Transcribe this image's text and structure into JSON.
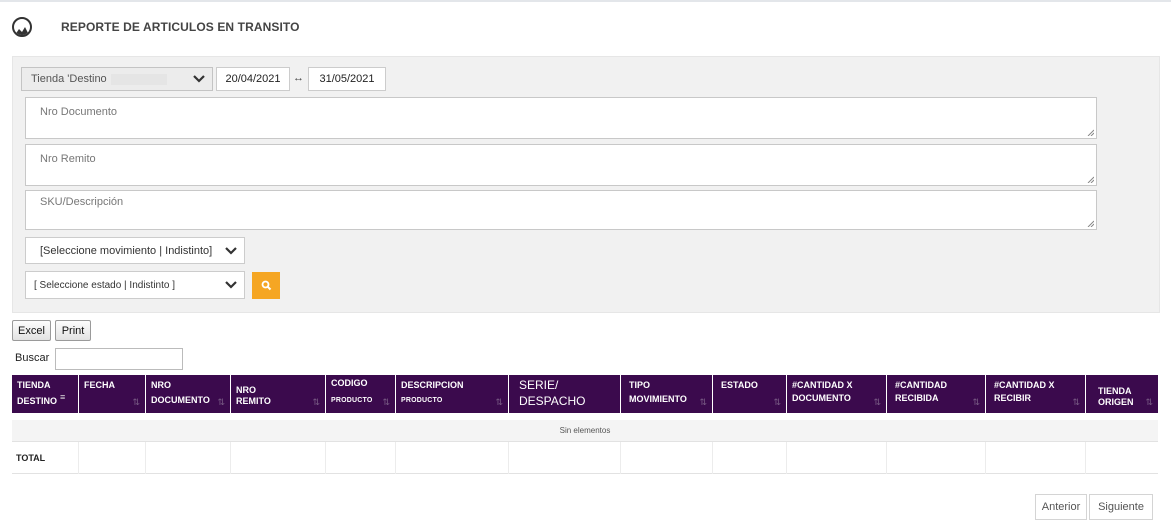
{
  "page": {
    "title": "REPORTE DE ARTICULOS EN TRANSITO"
  },
  "filters": {
    "store": {
      "label": "Tienda 'Destino"
    },
    "date_from": "20/04/2021",
    "date_range_arrow": "↔",
    "date_to": "31/05/2021",
    "nro_documento_placeholder": "Nro Documento",
    "nro_remito_placeholder": "Nro Remito",
    "sku_placeholder": "SKU/Descripción",
    "movimiento_select": "[Seleccione movimiento | Indistinto]",
    "estado_select": "[ Seleccione estado | Indistinto ]"
  },
  "toolbar": {
    "excel_label": "Excel",
    "print_label": "Print",
    "buscar_label": "Buscar"
  },
  "table": {
    "columns": [
      {
        "line1": "TIENDA",
        "line2": "DESTINO"
      },
      {
        "line1": "FECHA",
        "line2": ""
      },
      {
        "line1": "NRO",
        "line2": "DOCUMENTO"
      },
      {
        "line1": "NRO",
        "line2": "REMITO"
      },
      {
        "line1": "CODIGO",
        "line2": "PRODUCTO"
      },
      {
        "line1": "DESCRIPCION",
        "line2": "PRODUCTO"
      },
      {
        "line1": "SERIE/",
        "line2": "DESPACHO"
      },
      {
        "line1": "TIPO",
        "line2": "MOVIMIENTO"
      },
      {
        "line1": "ESTADO",
        "line2": ""
      },
      {
        "line1": "#CANTIDAD X",
        "line2": "DOCUMENTO"
      },
      {
        "line1": "#CANTIDAD",
        "line2": "RECIBIDA"
      },
      {
        "line1": "#CANTIDAD X",
        "line2": "RECIBIR"
      },
      {
        "line1": "TIENDA",
        "line2": "ORIGEN"
      }
    ],
    "empty_message": "Sin elementos",
    "total_label": "TOTAL"
  },
  "pagination": {
    "prev_label": "Anterior",
    "next_label": "Siguiente"
  },
  "colors": {
    "header_bg": "#3b0a4d",
    "search_button": "#f5a623",
    "filter_panel": "#f1f1f1"
  }
}
